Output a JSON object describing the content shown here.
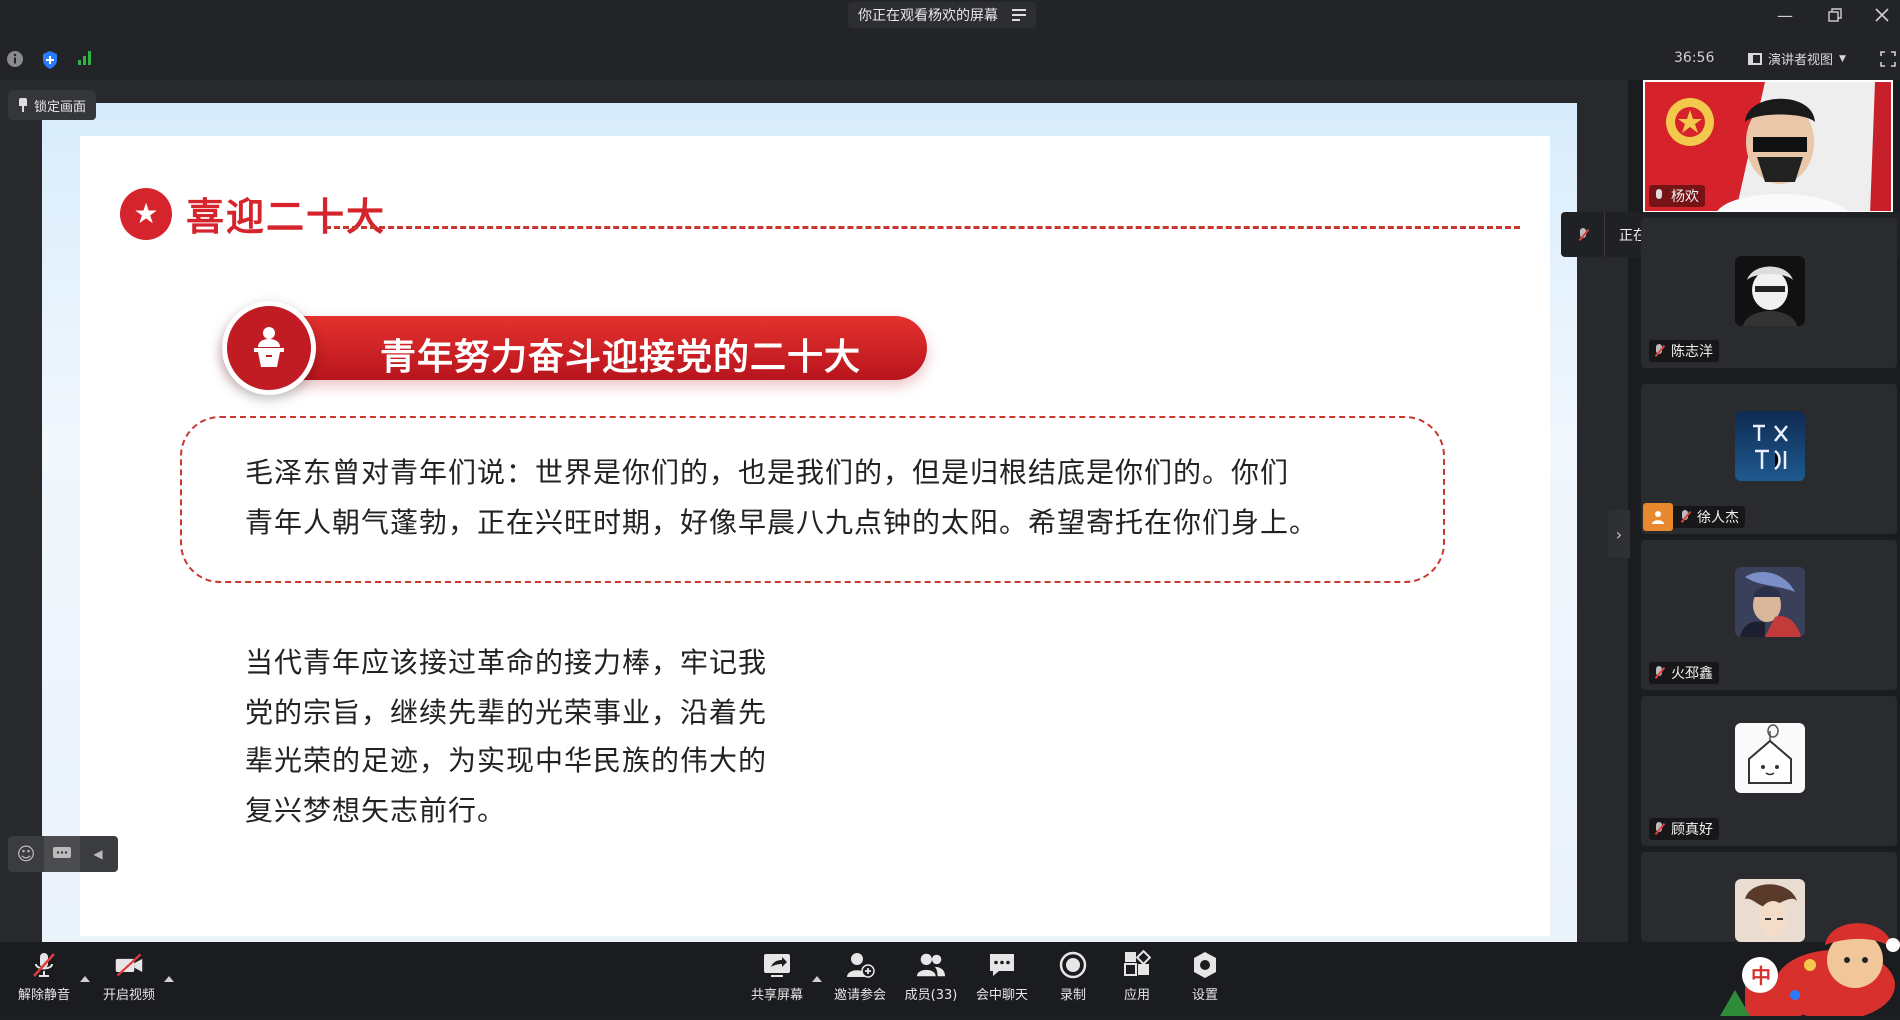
{
  "window": {
    "title": "你正在观看杨欢的屏幕",
    "minimize_icon": "minimize-icon",
    "restore_icon": "restore-icon",
    "close_icon": "close-icon"
  },
  "infobar": {
    "timer": "36:56",
    "view_mode": "演讲者视图",
    "fullscreen_icon": "fullscreen-icon"
  },
  "share": {
    "lock_label": "锁定画面"
  },
  "slide": {
    "title": "喜迎二十大",
    "banner": "青年努力奋斗迎接党的二十大",
    "quote_lines": [
      "毛泽东曾对青年们说：世界是你们的，也是我们的，但是归根结底是你们的。你们",
      "青年人朝气蓬勃，正在兴旺时期，好像早晨八九点钟的太阳。希望寄托在你们身上。"
    ],
    "body_lines": [
      "当代青年应该接过革命的接力棒，牢记我",
      "党的宗旨，继续先辈的光荣事业，沿着先",
      "辈光荣的足迹，为实现中华民族的伟大的",
      "复兴梦想矢志前行。"
    ]
  },
  "panel": {
    "presenter_name": "杨欢",
    "speaking_text": "正在讲话: 杨欢; 高岩;",
    "participants": [
      {
        "name": "陈志洋"
      },
      {
        "name": "徐人杰"
      },
      {
        "name": "火邳鑫"
      },
      {
        "name": "顾真好"
      }
    ]
  },
  "toolbar": {
    "unmute": "解除静音",
    "start_video": "开启视频",
    "share_screen": "共享屏幕",
    "invite": "邀请参会",
    "members": "成员(33)",
    "chat": "会中聊天",
    "record": "录制",
    "apps": "应用",
    "settings": "设置"
  },
  "colors": {
    "accent_red": "#d5242c",
    "dash_red": "#c8382e",
    "signal_green": "#2fb344",
    "shield_blue": "#2b7bff"
  }
}
